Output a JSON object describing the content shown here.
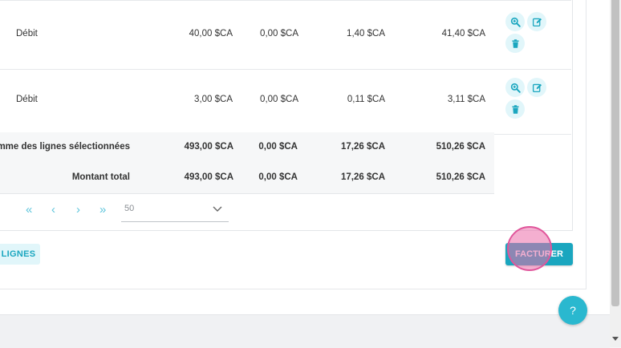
{
  "rows": [
    {
      "type": "Débit",
      "v1": "40,00 $CA",
      "v2": "0,00 $CA",
      "v3": "1,40 $CA",
      "v4": "41,40 $CA"
    },
    {
      "type": "Débit",
      "v1": "3,00 $CA",
      "v2": "0,00 $CA",
      "v3": "0,11 $CA",
      "v4": "3,11 $CA"
    }
  ],
  "summary": [
    {
      "label": "omme des lignes sélectionnées",
      "v1": "493,00 $CA",
      "v2": "0,00 $CA",
      "v3": "17,26 $CA",
      "v4": "510,26 $CA"
    },
    {
      "label": "Montant total",
      "v1": "493,00 $CA",
      "v2": "0,00 $CA",
      "v3": "17,26 $CA",
      "v4": "510,26 $CA"
    }
  ],
  "pagination": {
    "first": "«",
    "prev": "‹",
    "next": "›",
    "last": "»",
    "page_size": "50"
  },
  "buttons": {
    "lignes": "LIGNES",
    "facturer": "FACTURER",
    "help": "?"
  },
  "icons": {
    "view": "zoom-in-icon",
    "edit": "edit-icon",
    "delete": "trash-icon"
  },
  "colors": {
    "accent": "#1aa6bf",
    "accent_light": "#e1f6fa",
    "highlight": "#e0569b"
  }
}
